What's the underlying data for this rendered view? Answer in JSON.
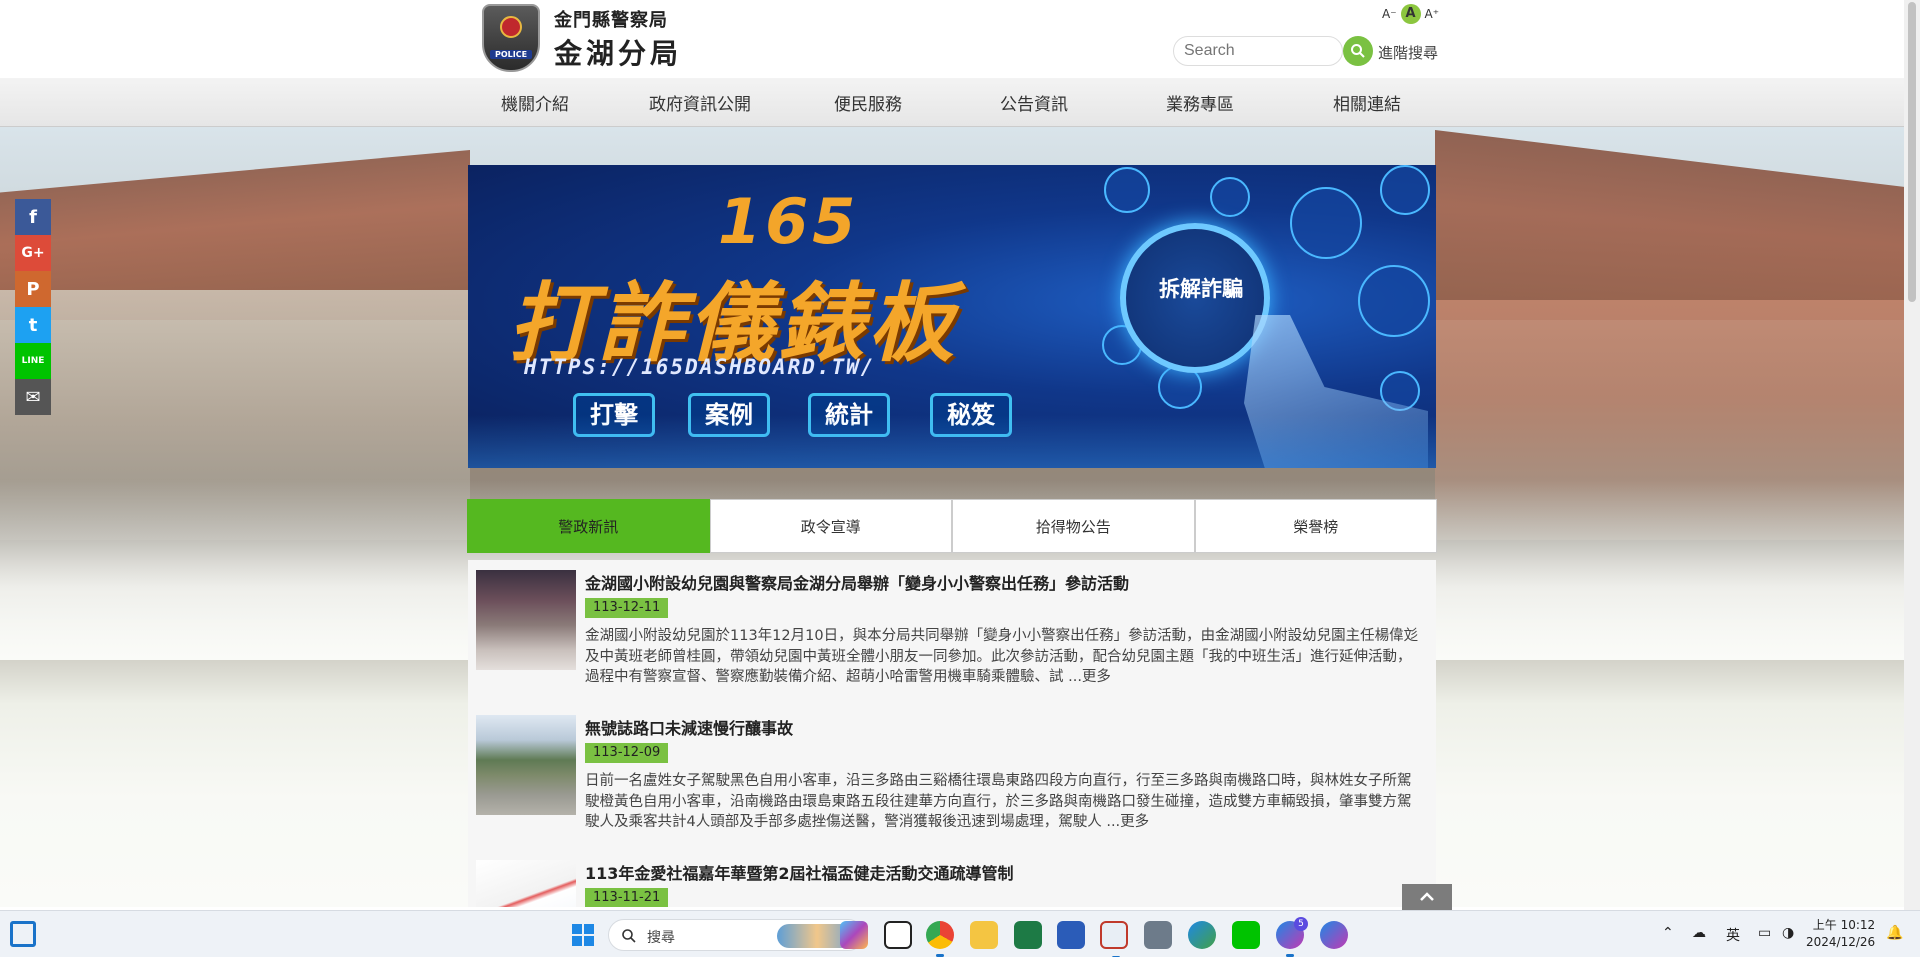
{
  "header": {
    "org_top": "金門縣警察局",
    "org_main": "金湖分局",
    "logo_text": "POLICE",
    "font_sizes": [
      "A⁻",
      "A",
      "A⁺"
    ],
    "search_placeholder": "Search",
    "advanced_search": "進階搜尋"
  },
  "nav": {
    "items": [
      "機關介紹",
      "政府資訊公開",
      "便民服務",
      "公告資訊",
      "業務專區",
      "相關連結"
    ]
  },
  "social": {
    "items": [
      {
        "name": "facebook",
        "glyph": "f",
        "color": "#3b5998"
      },
      {
        "name": "google-plus",
        "glyph": "G+",
        "color": "#dd4b39"
      },
      {
        "name": "plurk",
        "glyph": "P",
        "color": "#cf682f"
      },
      {
        "name": "twitter",
        "glyph": "t",
        "color": "#1da1f2"
      },
      {
        "name": "line",
        "glyph": "LINE",
        "color": "#00c300"
      },
      {
        "name": "email",
        "glyph": "✉",
        "color": "#555555"
      }
    ]
  },
  "banner": {
    "number": "165",
    "title": "打詐儀錶板",
    "url": "HTTPS://165DASHBOARD.TW/",
    "center": "拆解詐騙",
    "pills": [
      "打擊",
      "案例",
      "統計",
      "秘笈"
    ]
  },
  "tabs": {
    "items": [
      "警政新訊",
      "政令宣導",
      "拾得物公告",
      "榮譽榜"
    ],
    "active": "警政新訊"
  },
  "news": [
    {
      "title": "金湖國小附設幼兒園與警察局金湖分局舉辦「變身小小警察出任務」參訪活動",
      "date": "113-12-11",
      "summary": "金湖國小附設幼兒園於113年12月10日，與本分局共同舉辦「變身小小警察出任務」參訪活動，由金湖國小附設幼兒園主任楊偉彣及中黃班老師曾桂圓，帶領幼兒園中黃班全體小朋友一同參加。此次參訪活動，配合幼兒園主題「我的中班生活」進行延伸活動，過程中有警察宣督、警察應勤裝備介紹、超萌小哈雷警用機車騎乘體驗、試 ...更多"
    },
    {
      "title": "無號誌路口未減速慢行釀事故",
      "date": "113-12-09",
      "summary": "日前一名盧姓女子駕駛黑色自用小客車，沿三多路由三谿橋往環島東路四段方向直行，行至三多路與南機路口時，與林姓女子所駕駛橙黃色自用小客車，沿南機路由環島東路五段往建華方向直行，於三多路與南機路口發生碰撞，造成雙方車輛毀損，肇事雙方駕駛人及乘客共計4人頭部及手部多處挫傷送醫，警消獲報後迅速到場處理，駕駛人 ...更多"
    },
    {
      "title": "113年金愛社福嘉年華暨第2屆社福盃健走活動交通疏導管制",
      "date": "113-11-21",
      "summary": ""
    }
  ],
  "taskbar": {
    "search_label": "搜尋",
    "ime": "英",
    "time": "上午 10:12",
    "date": "2024/12/26",
    "messenger_badge": "5"
  },
  "colors": {
    "accent_green": "#55b820",
    "date_green": "#7ac142",
    "banner_gold": "#f4a62a"
  }
}
